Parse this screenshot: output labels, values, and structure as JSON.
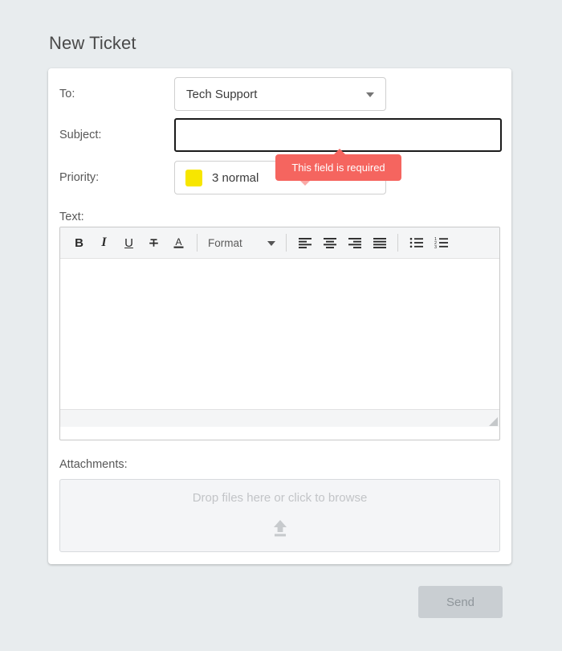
{
  "page": {
    "title": "New Ticket",
    "background_color": "#e8ecee"
  },
  "form": {
    "to": {
      "label": "To:",
      "value": "Tech Support",
      "caret_icon": "chevron-down-icon"
    },
    "subject": {
      "label": "Subject:",
      "value": "",
      "placeholder": "",
      "state": "invalid-focused",
      "border_color": "#1b1b1b"
    },
    "priority": {
      "label": "Priority:",
      "value": "3 normal",
      "swatch_color": "#f7e600",
      "caret_icon": "chevron-down-icon"
    },
    "text": {
      "label": "Text:",
      "value": "",
      "toolbar": {
        "bold_label": "B",
        "italic_label": "I",
        "underline_label": "U",
        "strikethrough_icon": "strikethrough-icon",
        "text_color_icon": "text-color-icon",
        "format_label": "Format",
        "align_left_icon": "align-left-icon",
        "align_center_icon": "align-center-icon",
        "align_right_icon": "align-right-icon",
        "align_justify_icon": "align-justify-icon",
        "bullet_list_icon": "bullet-list-icon",
        "numbered_list_icon": "numbered-list-icon"
      },
      "resize_handle_icon": "resize-grip-icon"
    },
    "attachments": {
      "label": "Attachments:",
      "dropzone_text": "Drop files here or click to browse",
      "upload_icon": "upload-icon"
    }
  },
  "validation": {
    "message": "This field is required",
    "color": "#f5655f",
    "target_field": "subject"
  },
  "actions": {
    "send_label": "Send",
    "send_disabled": true
  }
}
